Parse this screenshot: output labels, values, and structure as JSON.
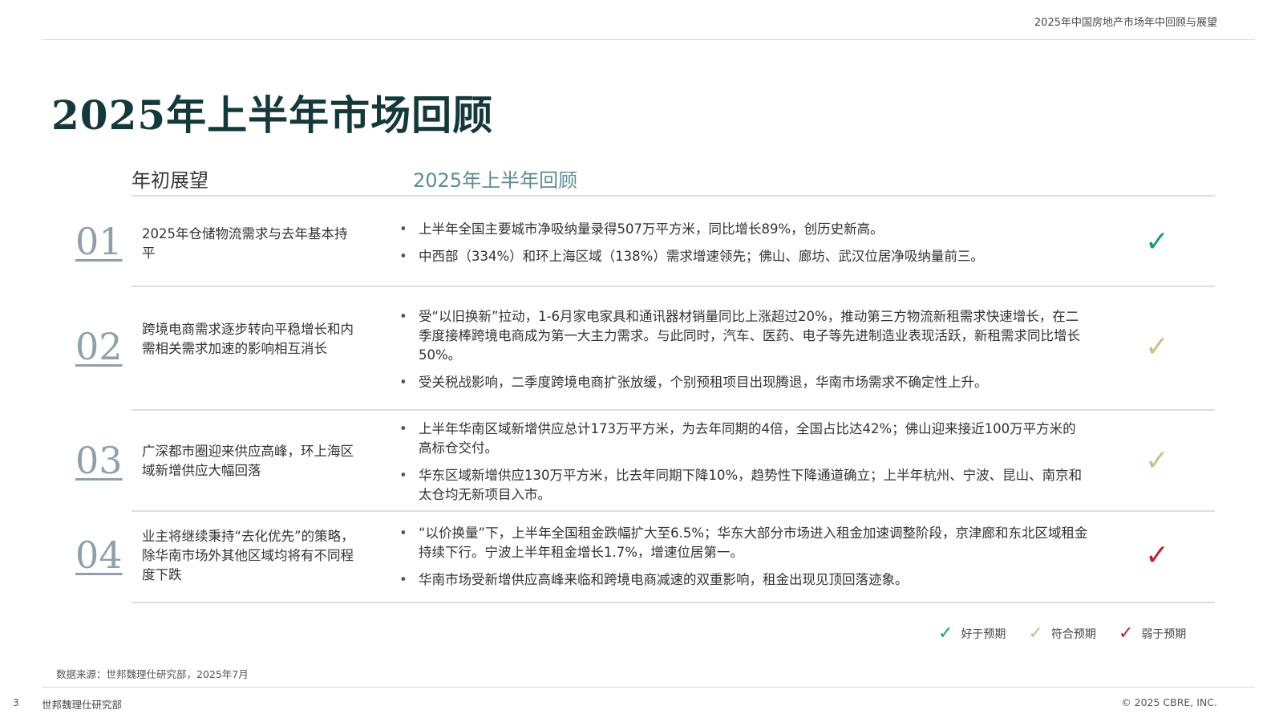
{
  "header": {
    "title": "2025年中国房地产市场年中回顾与展望"
  },
  "page_title": "2025年上半年市场回顾",
  "columns": {
    "left": "年初展望",
    "right": "2025年上半年回顾"
  },
  "colors": {
    "better": "#1a9a82",
    "meet": "#c9c18a",
    "worse": "#c0212b",
    "title": "#15383a",
    "accent": "#5e8c94"
  },
  "rows": [
    {
      "num": "01",
      "expectation": "2025年仓储物流需求与去年基本持平",
      "bullets": [
        "上半年全国主要城市净吸纳量录得507万平方米，同比增长89%，创历史新高。",
        "中西部（334%）和环上海区域（138%）需求增速领先；佛山、廊坊、武汉位居净吸纳量前三。"
      ],
      "status": "better",
      "check_icon": "✓"
    },
    {
      "num": "02",
      "expectation": "跨境电商需求逐步转向平稳增长和内需相关需求加速的影响相互消长",
      "bullets": [
        "受“以旧换新”拉动，1-6月家电家具和通讯器材销量同比上涨超过20%，推动第三方物流新租需求快速增长，在二季度接棒跨境电商成为第一大主力需求。与此同时，汽车、医药、电子等先进制造业表现活跃，新租需求同比增长50%。",
        "受关税战影响，二季度跨境电商扩张放缓，个别预租项目出现腾退，华南市场需求不确定性上升。"
      ],
      "status": "meet",
      "check_icon": "✓"
    },
    {
      "num": "03",
      "expectation": "广深都市圈迎来供应高峰，环上海区域新增供应大幅回落",
      "bullets": [
        "上半年华南区域新增供应总计173万平方米，为去年同期的4倍，全国占比达42%；佛山迎来接近100万平方米的高标仓交付。",
        "华东区域新增供应130万平方米，比去年同期下降10%，趋势性下降通道确立；上半年杭州、宁波、昆山、南京和太仓均无新项目入市。"
      ],
      "status": "meet",
      "check_icon": "✓"
    },
    {
      "num": "04",
      "expectation": "业主将继续秉持“去化优先”的策略，除华南市场外其他区域均将有不同程度下跌",
      "bullets": [
        "“以价换量”下，上半年全国租金跌幅扩大至6.5%；华东大部分市场进入租金加速调整阶段，京津廊和东北区域租金持续下行。宁波上半年租金增长1.7%，增速位居第一。",
        "华南市场受新增供应高峰来临和跨境电商减速的双重影响，租金出现见顶回落迹象。"
      ],
      "status": "worse",
      "check_icon": "✓"
    }
  ],
  "legend": [
    {
      "label": "好于预期",
      "status": "better",
      "icon": "✓"
    },
    {
      "label": "符合预期",
      "status": "meet",
      "icon": "✓"
    },
    {
      "label": "弱于预期",
      "status": "worse",
      "icon": "✓"
    }
  ],
  "source": "数据来源：世邦魏理仕研究部，2025年7月",
  "footer": {
    "page_number": "3",
    "org": "世邦魏理仕研究部",
    "copyright": "© 2025 CBRE, INC."
  }
}
